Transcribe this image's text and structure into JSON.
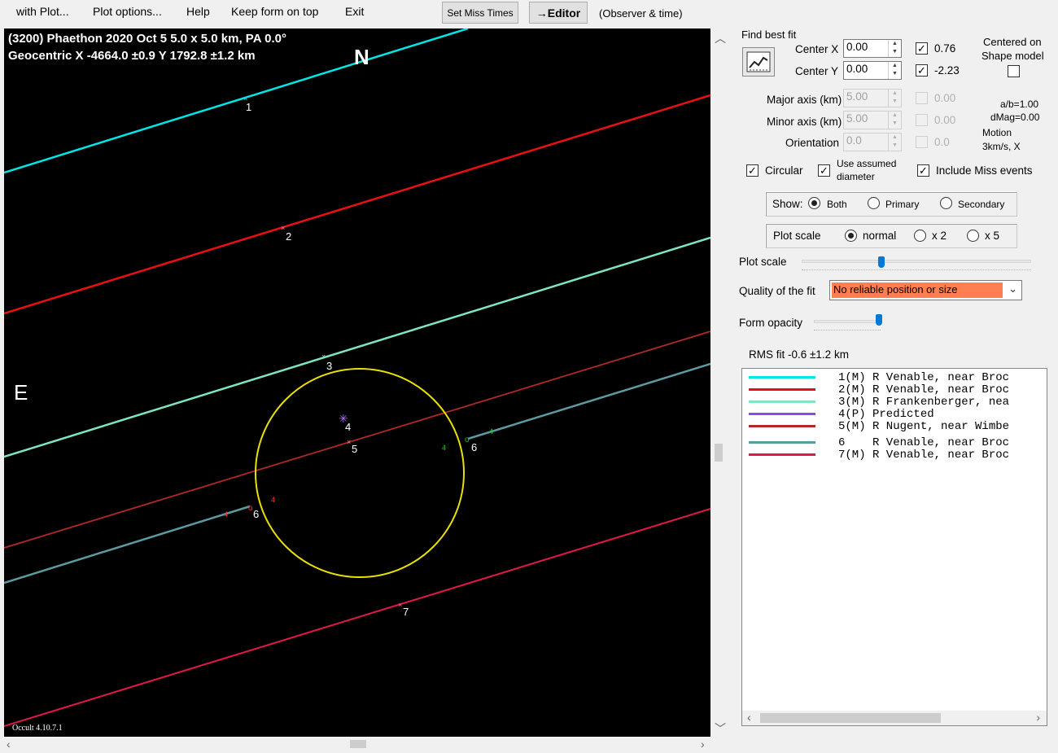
{
  "menu": {
    "with_plot": "with Plot...",
    "plot_options": "Plot options...",
    "help": "Help",
    "keep_on_top": "Keep form on top",
    "exit": "Exit",
    "set_miss_times": "Set Miss Times",
    "editor": "→Editor",
    "observer_time": "(Observer & time)"
  },
  "plot": {
    "header_line1": "(3200) Phaethon  2020 Oct 5   5.0 x 5.0 km, PA 0.0°",
    "header_line2": "Geocentric  X  -4664.0 ±0.9  Y 1792.8 ±1.2 km",
    "north": "N",
    "east": "E",
    "version": "Occult 4.10.7.1",
    "chord_labels": [
      "1",
      "2",
      "3",
      "4",
      "5",
      "6",
      "6",
      "7"
    ],
    "event_marks": [
      "4",
      "4",
      "4",
      "4"
    ],
    "colors": {
      "chord1": "#00e5e5",
      "chord2": "#e81010",
      "chord3": "#7fe5c0",
      "chord5": "#b02828",
      "chord6": "#5a9aa0",
      "chord7": "#e01848",
      "outline": "#e8e000",
      "predicted": "#b070ff"
    }
  },
  "fit": {
    "find_best_fit": "Find best fit",
    "center_x_label": "Center X",
    "center_x": "0.00",
    "center_x_fit": "0.76",
    "center_y_label": "Center Y",
    "center_y": "0.00",
    "center_y_fit": "-2.23",
    "centered_on": "Centered on",
    "shape_model": "Shape model",
    "major_label": "Major axis (km)",
    "major": "5.00",
    "major_fit": "0.00",
    "minor_label": "Minor axis (km)",
    "minor": "5.00",
    "minor_fit": "0.00",
    "orient_label": "Orientation",
    "orient": "0.0",
    "orient_fit": "0.0",
    "ab": "a/b=1.00",
    "dmag": "dMag=0.00",
    "motion": "Motion",
    "motion_val": "3km/s, X",
    "circular": "Circular",
    "use_assumed": "Use assumed",
    "diameter": "diameter",
    "include_miss": "Include Miss events"
  },
  "show": {
    "label": "Show:",
    "both": "Both",
    "primary": "Primary",
    "secondary": "Secondary"
  },
  "scale": {
    "label": "Plot scale",
    "normal": "normal",
    "x2": "x 2",
    "x5": "x 5",
    "slider_label": "Plot scale"
  },
  "quality": {
    "label": "Quality of the fit",
    "value": "No reliable position or size"
  },
  "opacity_label": "Form opacity",
  "rms": "RMS fit -0.6 ±1.2 km",
  "legend": [
    {
      "text": "1(M) R Venable, near Broc",
      "color": "#00e5e5"
    },
    {
      "text": "2(M) R Venable, near Broc",
      "color": "#e81010"
    },
    {
      "text": "3(M) R Frankenberger, nea",
      "color": "#7fe5c0"
    },
    {
      "text": "4(P) Predicted",
      "color": "#9048e0"
    },
    {
      "text": "5(M) R Nugent, near Wimbe",
      "color": "#b02828"
    },
    {
      "text": "6    R Venable, near Broc",
      "color": "#5a9aa0"
    },
    {
      "text": "7(M) R Venable, near Broc",
      "color": "#e01848"
    }
  ]
}
